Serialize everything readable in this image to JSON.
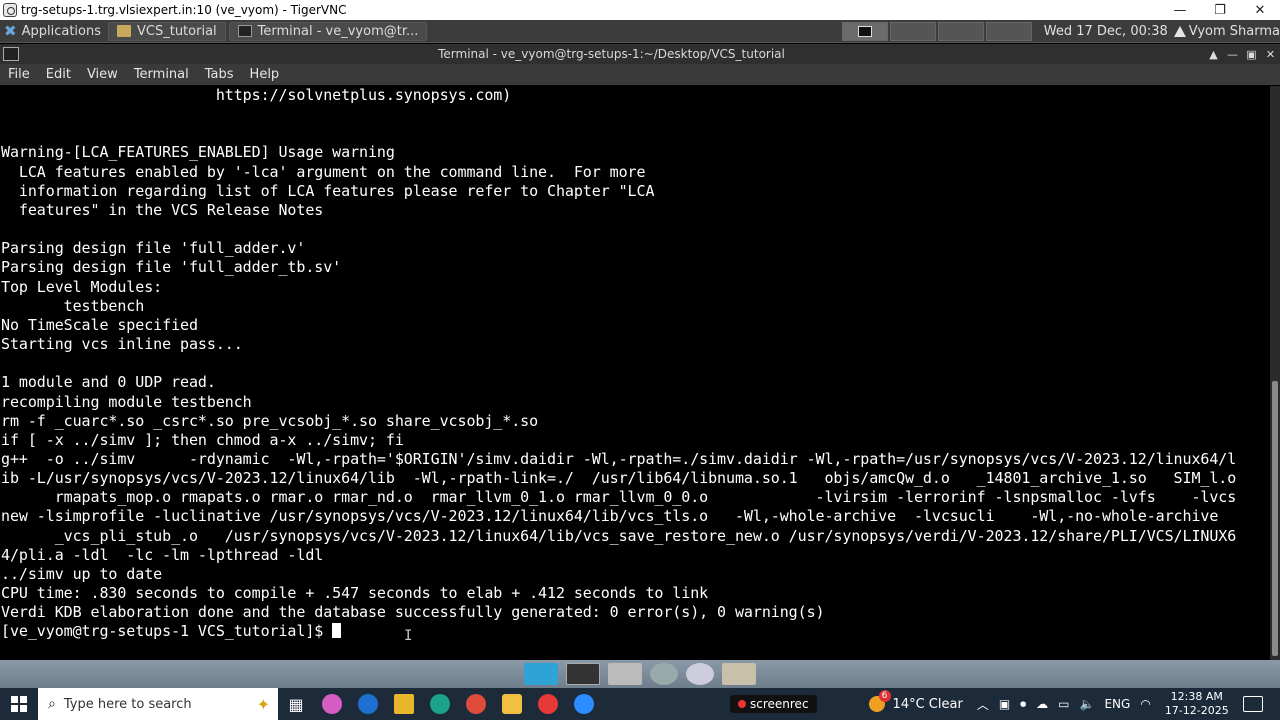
{
  "vnc_window": {
    "title": "trg-setups-1.trg.vlsiexpert.in:10 (ve_vyom) - TigerVNC",
    "minimize": "—",
    "maximize": "❐",
    "close": "✕"
  },
  "top_panel": {
    "applications_label": "Applications",
    "tasks": [
      {
        "label": "VCS_tutorial",
        "icon": "folder-icon"
      },
      {
        "label": "Terminal - ve_vyom@tr...",
        "icon": "terminal-icon"
      }
    ],
    "clock": "Wed 17 Dec, 00:38",
    "user": "Vyom Sharma"
  },
  "terminal_window": {
    "title": "Terminal - ve_vyom@trg-setups-1:~/Desktop/VCS_tutorial",
    "buttons": [
      "▲",
      "—",
      "▣",
      "✕"
    ]
  },
  "menubar": {
    "items": [
      "File",
      "Edit",
      "View",
      "Terminal",
      "Tabs",
      "Help"
    ]
  },
  "terminal": {
    "lines": [
      "                        https://solvnetplus.synopsys.com)",
      "",
      "",
      "Warning-[LCA_FEATURES_ENABLED] Usage warning",
      "  LCA features enabled by '-lca' argument on the command line.  For more",
      "  information regarding list of LCA features please refer to Chapter \"LCA",
      "  features\" in the VCS Release Notes",
      "",
      "Parsing design file 'full_adder.v'",
      "Parsing design file 'full_adder_tb.sv'",
      "Top Level Modules:",
      "       testbench",
      "No TimeScale specified",
      "Starting vcs inline pass...",
      "",
      "1 module and 0 UDP read.",
      "recompiling module testbench",
      "rm -f _cuarc*.so _csrc*.so pre_vcsobj_*.so share_vcsobj_*.so",
      "if [ -x ../simv ]; then chmod a-x ../simv; fi",
      "g++  -o ../simv      -rdynamic  -Wl,-rpath='$ORIGIN'/simv.daidir -Wl,-rpath=./simv.daidir -Wl,-rpath=/usr/synopsys/vcs/V-2023.12/linux64/l",
      "ib -L/usr/synopsys/vcs/V-2023.12/linux64/lib  -Wl,-rpath-link=./  /usr/lib64/libnuma.so.1   objs/amcQw_d.o   _14801_archive_1.so   SIM_l.o",
      "      rmapats_mop.o rmapats.o rmar.o rmar_nd.o  rmar_llvm_0_1.o rmar_llvm_0_0.o            -lvirsim -lerrorinf -lsnpsmalloc -lvfs    -lvcs",
      "new -lsimprofile -luclinative /usr/synopsys/vcs/V-2023.12/linux64/lib/vcs_tls.o   -Wl,-whole-archive  -lvcsucli    -Wl,-no-whole-archive",
      "      _vcs_pli_stub_.o   /usr/synopsys/vcs/V-2023.12/linux64/lib/vcs_save_restore_new.o /usr/synopsys/verdi/V-2023.12/share/PLI/VCS/LINUX6",
      "4/pli.a -ldl  -lc -lm -lpthread -ldl",
      "../simv up to date",
      "CPU time: .830 seconds to compile + .547 seconds to elab + .412 seconds to link",
      "Verdi KDB elaboration done and the database successfully generated: 0 error(s), 0 warning(s)"
    ],
    "prompt": "[ve_vyom@trg-setups-1 VCS_tutorial]$ "
  },
  "taskbar": {
    "search_placeholder": "Type here to search",
    "screenrec_label": "screenrec",
    "weather": "14°C  Clear",
    "weather_badge": "6",
    "language": "ENG",
    "time": "12:38 AM",
    "date": "17-12-2025"
  }
}
